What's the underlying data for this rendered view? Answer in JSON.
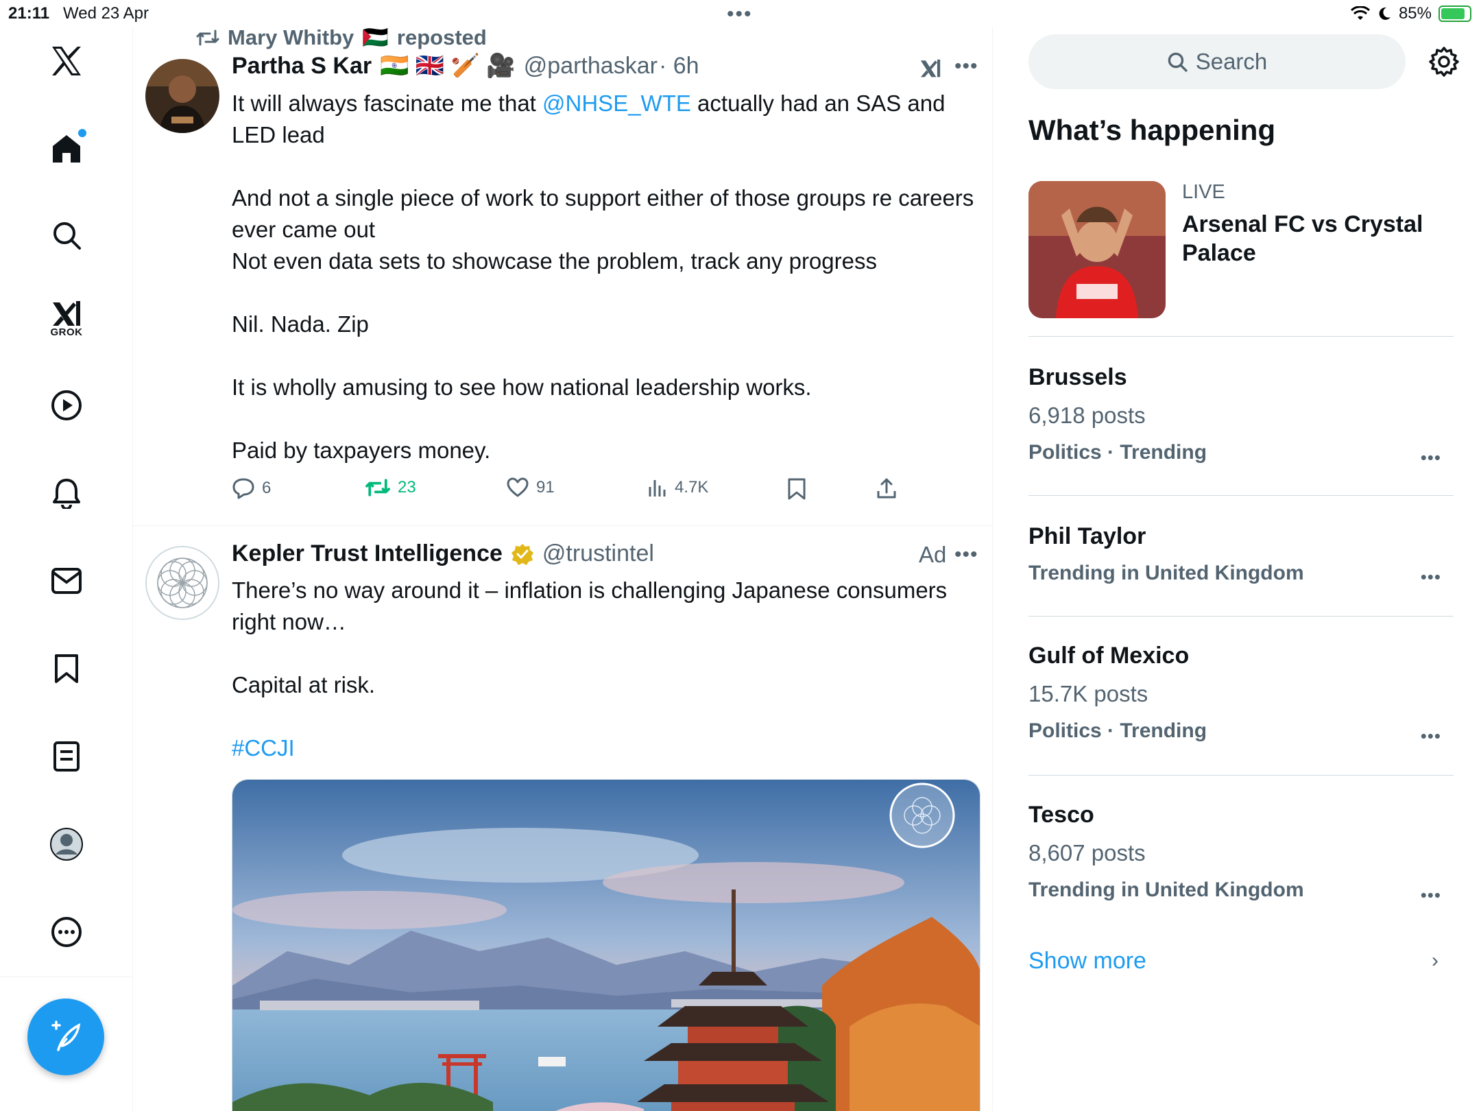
{
  "status_bar": {
    "time": "21:11",
    "date": "Wed 23 Apr",
    "battery": "85%",
    "battery_level": 0.85
  },
  "nav": {
    "items": [
      "home",
      "explore",
      "grok",
      "videos",
      "notifications",
      "messages",
      "bookmarks",
      "lists",
      "profile",
      "more"
    ],
    "grok_label": "GROK"
  },
  "feed": {
    "tweet1": {
      "repost_by": "Mary Whitby",
      "repost_flag": "🇵🇸",
      "repost_suffix": "reposted",
      "author_name": "Partha S Kar",
      "author_emojis": "🇮🇳 🇬🇧 🏏 🎥",
      "handle": "@parthaskar",
      "time": "· 6h",
      "text_line1_prefix": "It will always fascinate me that ",
      "mention": "@NHSE_WTE",
      "text_line1_suffix": " actually had an SAS and LED lead",
      "para2": "And not a single piece of work to support either of those groups re careers ever came out",
      "para3": "Not even data sets to showcase the problem, track any progress",
      "para4": "Nil. Nada. Zip",
      "para5": "It is wholly amusing to see how national leadership works.",
      "para6": "Paid by taxpayers money.",
      "replies": "6",
      "reposts": "23",
      "likes": "91",
      "views": "4.7K"
    },
    "tweet2": {
      "author_name": "Kepler Trust Intelligence",
      "handle": "@trustintel",
      "ad_label": "Ad",
      "text": "There’s no way around it – inflation is challenging Japanese consumers right now…",
      "para2": "Capital at risk.",
      "hashtag": "#CCJI"
    }
  },
  "sidebar": {
    "search_placeholder": "Search",
    "title": "What’s happening",
    "live": {
      "tag": "LIVE",
      "title": "Arsenal FC vs Crystal Palace"
    },
    "trends": [
      {
        "name": "Brussels",
        "posts": "6,918 posts",
        "context": "Politics · Trending"
      },
      {
        "name": "Phil Taylor",
        "posts": "",
        "context": "Trending in United Kingdom"
      },
      {
        "name": "Gulf of Mexico",
        "posts": "15.7K posts",
        "context": "Politics · Trending"
      },
      {
        "name": "Tesco",
        "posts": "8,607 posts",
        "context": "Trending in United Kingdom"
      }
    ],
    "show_more": "Show more"
  },
  "colors": {
    "accent": "#1d9bf0",
    "repost_green": "#00ba7c",
    "muted_text": "#536471"
  }
}
